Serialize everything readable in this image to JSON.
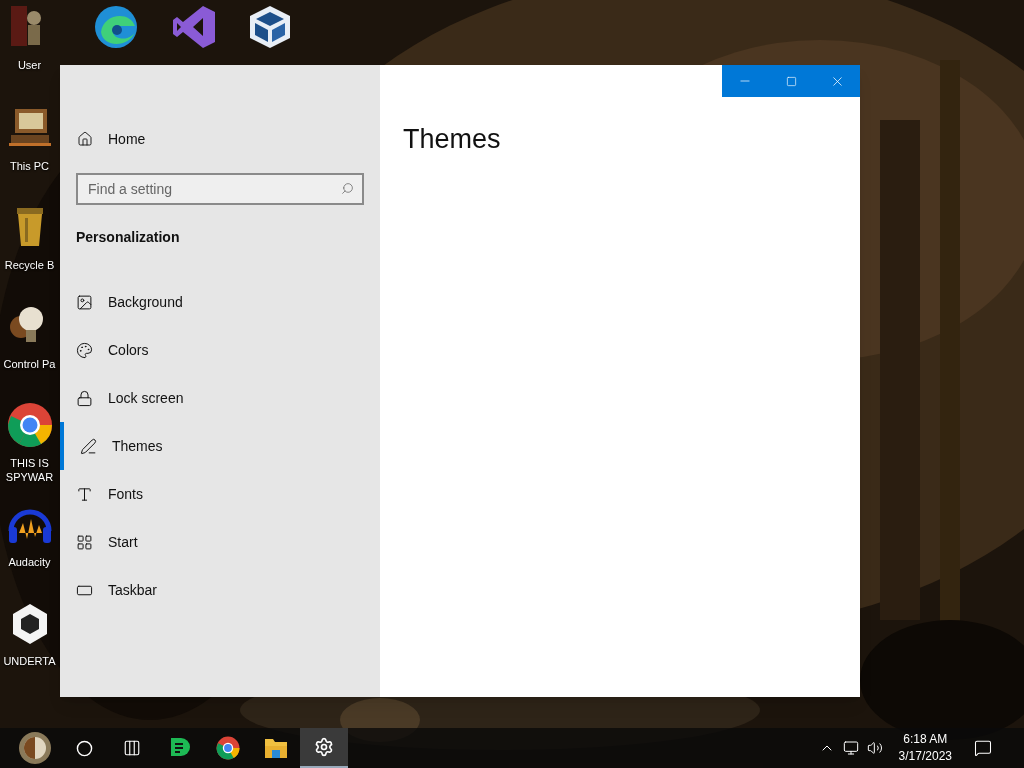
{
  "desktop": {
    "icons": [
      {
        "kind": "figure",
        "label": "User"
      },
      {
        "kind": "edge"
      },
      {
        "kind": "studio"
      },
      {
        "kind": "cube"
      },
      {
        "kind": "computer",
        "label": "This PC"
      },
      {
        "kind": "bin",
        "label": "Recycle B"
      },
      {
        "kind": "bulb",
        "label": "Control Pa"
      },
      {
        "kind": "chrome",
        "label": "THIS IS SPYWAR"
      },
      {
        "kind": "headphones",
        "label": "Audacity"
      },
      {
        "kind": "unity",
        "label": "UNDERTA"
      }
    ]
  },
  "window": {
    "sidebar": {
      "home": "Home",
      "search": {
        "placeholder": "Find a setting"
      },
      "section": "Personalization",
      "items": [
        {
          "label": "Background",
          "selected": false
        },
        {
          "label": "Colors",
          "selected": false
        },
        {
          "label": "Lock screen",
          "selected": false
        },
        {
          "label": "Themes",
          "selected": true
        },
        {
          "label": "Fonts",
          "selected": false
        },
        {
          "label": "Start",
          "selected": false
        },
        {
          "label": "Taskbar",
          "selected": false
        }
      ]
    },
    "page_title": "Themes"
  },
  "taskbar": {
    "apps": [
      {
        "kind": "start",
        "selected": false
      },
      {
        "kind": "search",
        "selected": false
      },
      {
        "kind": "taskview",
        "selected": false
      },
      {
        "kind": "chat",
        "selected": false
      },
      {
        "kind": "chrome",
        "selected": false
      },
      {
        "kind": "folder",
        "selected": false
      },
      {
        "kind": "settings",
        "selected": true
      }
    ],
    "time": "6:18 AM",
    "date": "3/17/2023"
  }
}
